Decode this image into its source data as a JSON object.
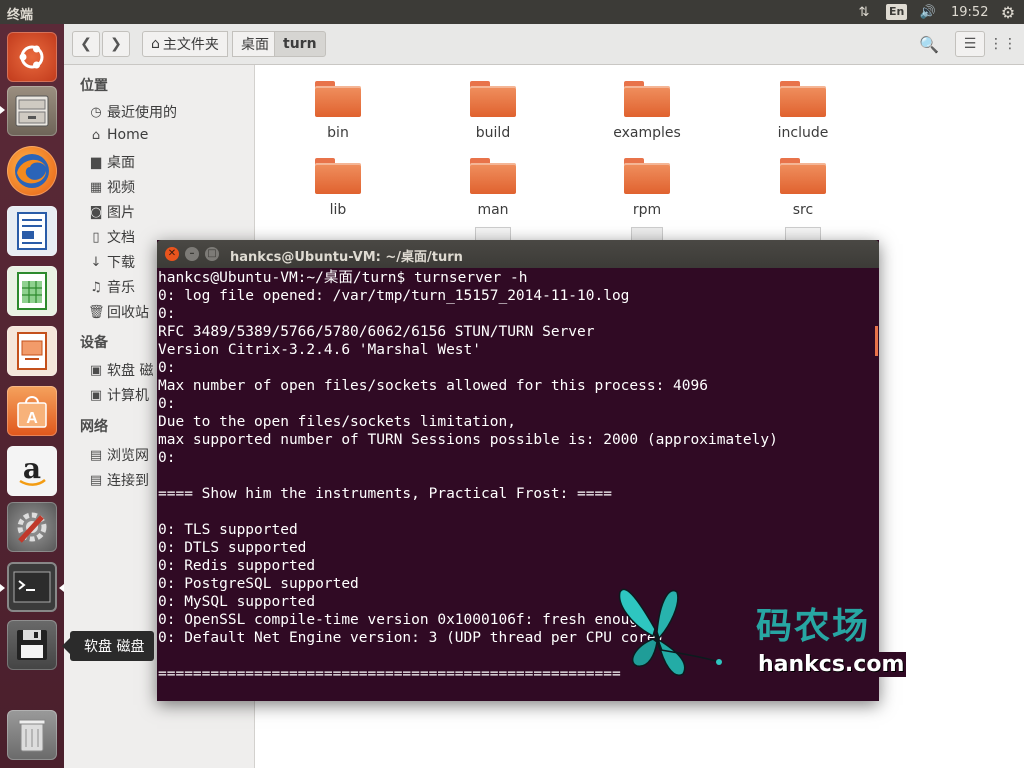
{
  "topbar": {
    "title": "终端",
    "lang": "En",
    "time": "19:52"
  },
  "launcher": {
    "tooltip": "软盘 磁盘"
  },
  "file_manager": {
    "breadcrumbs": [
      "主文件夹",
      "桌面",
      "turn"
    ],
    "sidebar": {
      "places_header": "位置",
      "places": [
        {
          "icon": "recent-icon",
          "label": "最近使用的"
        },
        {
          "icon": "home-icon",
          "label": "Home"
        },
        {
          "icon": "desktop-icon",
          "label": "桌面"
        },
        {
          "icon": "videos-icon",
          "label": "视频"
        },
        {
          "icon": "pictures-icon",
          "label": "图片"
        },
        {
          "icon": "documents-icon",
          "label": "文档"
        },
        {
          "icon": "downloads-icon",
          "label": "下载"
        },
        {
          "icon": "music-icon",
          "label": "音乐"
        },
        {
          "icon": "trash-icon",
          "label": "回收站"
        }
      ],
      "devices_header": "设备",
      "devices": [
        {
          "icon": "floppy-icon",
          "label": "软盘 磁"
        },
        {
          "icon": "computer-icon",
          "label": "计算机"
        }
      ],
      "network_header": "网络",
      "network": [
        {
          "icon": "browse-network-icon",
          "label": "浏览网"
        },
        {
          "icon": "connect-server-icon",
          "label": "连接到"
        }
      ]
    },
    "files": [
      "bin",
      "build",
      "examples",
      "include",
      "lib",
      "man",
      "rpm",
      "src"
    ]
  },
  "terminal": {
    "title": "hankcs@Ubuntu-VM: ~/桌面/turn",
    "lines": [
      "hankcs@Ubuntu-VM:~/桌面/turn$ turnserver -h",
      "0: log file opened: /var/tmp/turn_15157_2014-11-10.log",
      "0:",
      "RFC 3489/5389/5766/5780/6062/6156 STUN/TURN Server",
      "Version Citrix-3.2.4.6 'Marshal West'",
      "0:",
      "Max number of open files/sockets allowed for this process: 4096",
      "0:",
      "Due to the open files/sockets limitation,",
      "max supported number of TURN Sessions possible is: 2000 (approximately)",
      "0:",
      "",
      "==== Show him the instruments, Practical Frost: ====",
      "",
      "0: TLS supported",
      "0: DTLS supported",
      "0: Redis supported",
      "0: PostgreSQL supported",
      "0: MySQL supported",
      "0: OpenSSL compile-time version 0x1000106f: fresh enough",
      "0: Default Net Engine version: 3 (UDP thread per CPU core)",
      "",
      "====================================================="
    ]
  },
  "watermark": {
    "cn": "码农场",
    "en": "hankcs.com"
  }
}
